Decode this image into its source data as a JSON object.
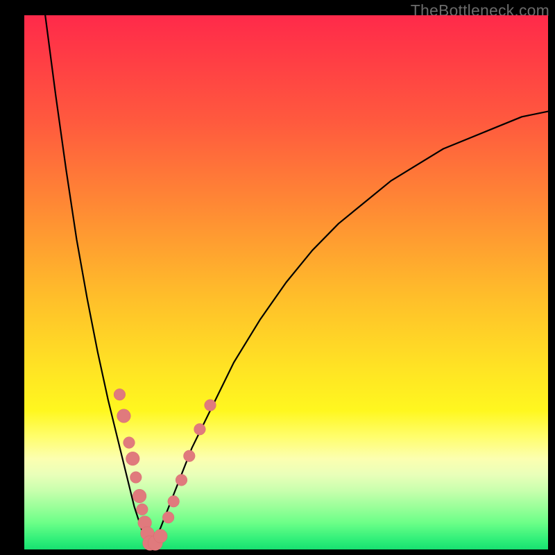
{
  "watermark": "TheBottleneck.com",
  "colors": {
    "frame": "#000000",
    "curve_stroke": "#000000",
    "marker_fill": "#e07a7d",
    "marker_stroke": "#d86c6f"
  },
  "chart_data": {
    "type": "line",
    "title": "",
    "xlabel": "",
    "ylabel": "",
    "xlim": [
      0,
      100
    ],
    "ylim": [
      0,
      100
    ],
    "grid": false,
    "x_minimum": 24,
    "series": [
      {
        "name": "left-branch",
        "x": [
          4,
          6,
          8,
          10,
          12,
          14,
          16,
          18,
          20,
          21,
          22,
          23,
          24
        ],
        "y": [
          100,
          85,
          71,
          58,
          47,
          37,
          28,
          20,
          12,
          8,
          5,
          2,
          0
        ]
      },
      {
        "name": "right-branch",
        "x": [
          24,
          26,
          28,
          30,
          32,
          35,
          40,
          45,
          50,
          55,
          60,
          65,
          70,
          75,
          80,
          85,
          90,
          95,
          100
        ],
        "y": [
          0,
          4,
          9,
          14,
          19,
          25,
          35,
          43,
          50,
          56,
          61,
          65,
          69,
          72,
          75,
          77,
          79,
          81,
          82
        ]
      }
    ],
    "markers": [
      {
        "x": 18.2,
        "y": 29.0,
        "r": 1.1
      },
      {
        "x": 19.0,
        "y": 25.0,
        "r": 1.3
      },
      {
        "x": 20.0,
        "y": 20.0,
        "r": 1.1
      },
      {
        "x": 20.7,
        "y": 17.0,
        "r": 1.3
      },
      {
        "x": 21.3,
        "y": 13.5,
        "r": 1.1
      },
      {
        "x": 22.0,
        "y": 10.0,
        "r": 1.3
      },
      {
        "x": 22.5,
        "y": 7.5,
        "r": 1.1
      },
      {
        "x": 23.0,
        "y": 5.0,
        "r": 1.3
      },
      {
        "x": 23.5,
        "y": 3.0,
        "r": 1.3
      },
      {
        "x": 24.0,
        "y": 1.2,
        "r": 1.4
      },
      {
        "x": 25.0,
        "y": 1.2,
        "r": 1.4
      },
      {
        "x": 26.0,
        "y": 2.5,
        "r": 1.3
      },
      {
        "x": 27.5,
        "y": 6.0,
        "r": 1.1
      },
      {
        "x": 28.5,
        "y": 9.0,
        "r": 1.1
      },
      {
        "x": 30.0,
        "y": 13.0,
        "r": 1.1
      },
      {
        "x": 31.5,
        "y": 17.5,
        "r": 1.1
      },
      {
        "x": 33.5,
        "y": 22.5,
        "r": 1.1
      },
      {
        "x": 35.5,
        "y": 27.0,
        "r": 1.1
      }
    ]
  }
}
